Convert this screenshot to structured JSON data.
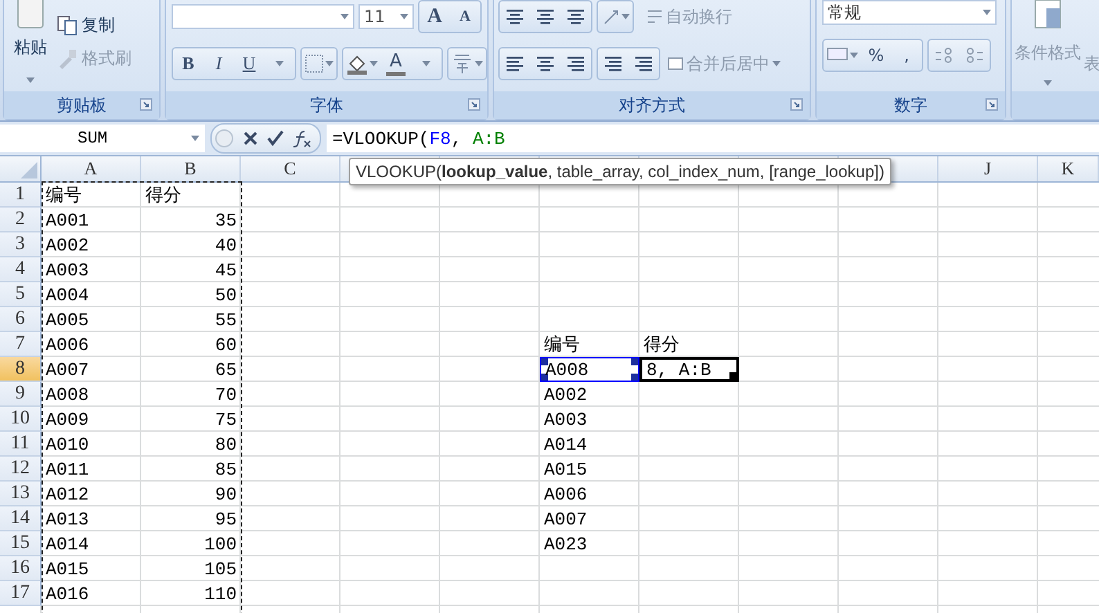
{
  "ribbon": {
    "groups": [
      {
        "kind": "clipboard",
        "label": "剪贴板",
        "paste": "粘贴",
        "commands": [
          {
            "label": "复制",
            "disabled": false
          },
          {
            "label": "格式刷",
            "disabled": true
          }
        ]
      },
      {
        "kind": "font",
        "label": "字体",
        "font_size": "11",
        "grow": "A",
        "shrink": "A",
        "styles": [
          "B",
          "I",
          "U"
        ],
        "font_color": "A"
      },
      {
        "kind": "alignment",
        "label": "对齐方式",
        "commands": [
          {
            "label": "自动换行",
            "disabled": true
          },
          {
            "label": "合并后居中",
            "disabled": true
          }
        ]
      },
      {
        "kind": "number",
        "label": "数字",
        "format": "常规",
        "symbols": [
          "%",
          ","
        ]
      },
      {
        "kind": "styles",
        "commands": [
          {
            "label": "条件格式",
            "disabled": true
          },
          {
            "label": "表",
            "disabled": true
          }
        ]
      }
    ]
  },
  "formula_bar": {
    "name_box": "SUM",
    "formula": [
      {
        "text": "=VLOOKUP(",
        "kind": "plain"
      },
      {
        "text": "F8",
        "kind": "ref",
        "color": "#0000ff"
      },
      {
        "text": ", ",
        "kind": "plain"
      },
      {
        "text": "A:B",
        "kind": "ref",
        "color": "#008000"
      }
    ],
    "tooltip": "VLOOKUP(**lookup_value**, table_array, col_index_num, [range_lookup])"
  },
  "grid": {
    "columns": [
      {
        "label": "A",
        "copied": true
      },
      {
        "label": "B",
        "copied": true
      },
      {
        "label": "C",
        "copied": false
      },
      null,
      null,
      null,
      null,
      null,
      null,
      {
        "label": "J",
        "copied": false
      },
      {
        "label": "K",
        "copied": false
      }
    ],
    "rows": [
      {
        "number": "1",
        "selected": false,
        "cells": [
          "编号",
          "得分"
        ]
      },
      {
        "number": "2",
        "selected": false,
        "cells": [
          "A001",
          "35"
        ]
      },
      {
        "number": "3",
        "selected": false,
        "cells": [
          "A002",
          "40"
        ]
      },
      {
        "number": "4",
        "selected": false,
        "cells": [
          "A003",
          "45"
        ]
      },
      {
        "number": "5",
        "selected": false,
        "cells": [
          "A004",
          "50"
        ]
      },
      {
        "number": "6",
        "selected": false,
        "cells": [
          "A005",
          "55"
        ]
      },
      {
        "number": "7",
        "selected": false,
        "cells": [
          "A006",
          "60",
          null,
          null,
          null,
          "编号",
          "得分"
        ]
      },
      {
        "number": "8",
        "selected": true,
        "cells": [
          "A007",
          "65",
          null,
          null,
          null,
          {
            "text": "A008",
            "reference": true,
            "editing": false
          },
          {
            "text": "8, A:B",
            "reference": false,
            "editing": true
          }
        ]
      },
      {
        "number": "9",
        "selected": false,
        "cells": [
          "A008",
          "70",
          null,
          null,
          null,
          "A002"
        ]
      },
      {
        "number": "10",
        "selected": false,
        "cells": [
          "A009",
          "75",
          null,
          null,
          null,
          "A003"
        ]
      },
      {
        "number": "11",
        "selected": false,
        "cells": [
          "A010",
          "80",
          null,
          null,
          null,
          "A014"
        ]
      },
      {
        "number": "12",
        "selected": false,
        "cells": [
          "A011",
          "85",
          null,
          null,
          null,
          "A015"
        ]
      },
      {
        "number": "13",
        "selected": false,
        "cells": [
          "A012",
          "90",
          null,
          null,
          null,
          "A006"
        ]
      },
      {
        "number": "14",
        "selected": false,
        "cells": [
          "A013",
          "95",
          null,
          null,
          null,
          "A007"
        ]
      },
      {
        "number": "15",
        "selected": false,
        "cells": [
          "A014",
          "100",
          null,
          null,
          null,
          "A023"
        ]
      },
      {
        "number": "16",
        "selected": false,
        "cells": [
          "A015",
          "105"
        ]
      },
      {
        "number": "17",
        "selected": false,
        "cells": [
          "A016",
          "110"
        ]
      }
    ]
  }
}
